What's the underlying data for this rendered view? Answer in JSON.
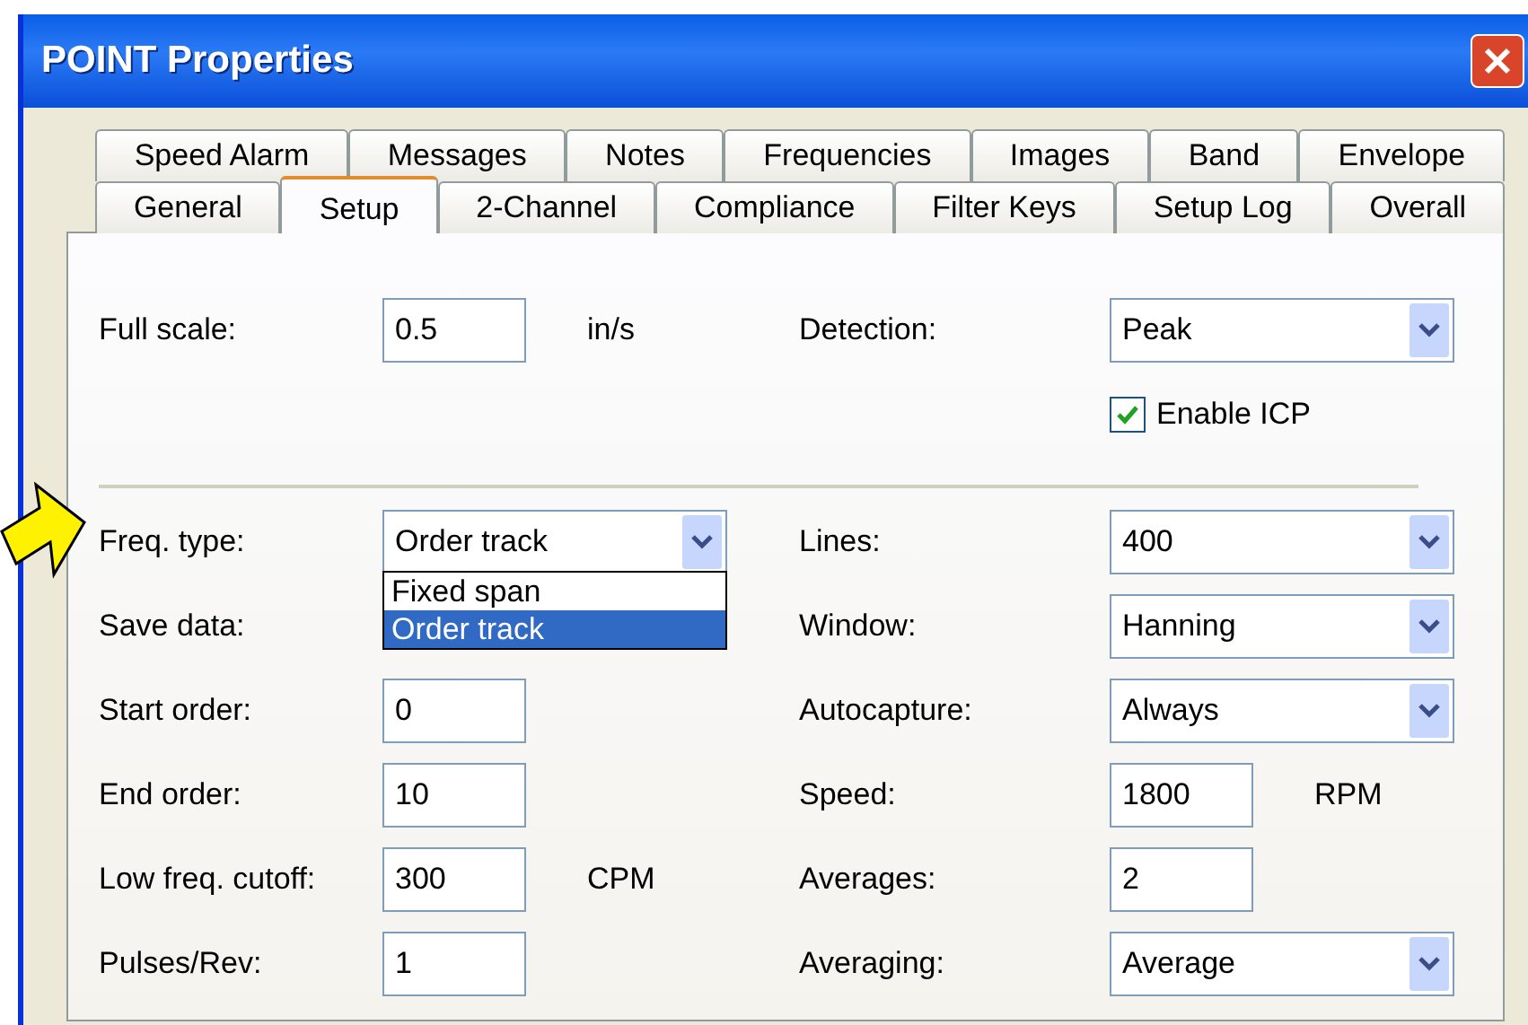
{
  "window": {
    "title": "POINT Properties"
  },
  "tab_rows": [
    {
      "tabs": [
        {
          "label": "Speed Alarm",
          "selected": false
        },
        {
          "label": "Messages",
          "selected": false
        },
        {
          "label": "Notes",
          "selected": false
        },
        {
          "label": "Frequencies",
          "selected": false
        },
        {
          "label": "Images",
          "selected": false
        },
        {
          "label": "Band",
          "selected": false
        },
        {
          "label": "Envelope",
          "selected": false
        }
      ]
    },
    {
      "tabs": [
        {
          "label": "General",
          "selected": false
        },
        {
          "label": "Setup",
          "selected": true
        },
        {
          "label": "2-Channel",
          "selected": false
        },
        {
          "label": "Compliance",
          "selected": false
        },
        {
          "label": "Filter Keys",
          "selected": false
        },
        {
          "label": "Setup Log",
          "selected": false
        },
        {
          "label": "Overall",
          "selected": false
        }
      ]
    }
  ],
  "sections": [
    {
      "rows": [
        {
          "left": {
            "kind": "text",
            "label": "Full scale:",
            "value": "0.5",
            "unit": "in/s"
          },
          "right": {
            "kind": "combo",
            "label": "Detection:",
            "value": "Peak"
          }
        },
        {
          "right": {
            "kind": "check",
            "label": "Enable ICP",
            "checked": true
          }
        }
      ]
    },
    {
      "rows": [
        {
          "left": {
            "kind": "combo",
            "label": "Freq. type:",
            "value": "Order track",
            "options": [
              {
                "label": "Fixed span",
                "selected": false
              },
              {
                "label": "Order track",
                "selected": true
              }
            ]
          },
          "right": {
            "kind": "combo",
            "label": "Lines:",
            "value": "400"
          }
        },
        {
          "left": {
            "kind": "label",
            "label": "Save data:"
          },
          "right": {
            "kind": "combo",
            "label": "Window:",
            "value": "Hanning"
          }
        },
        {
          "left": {
            "kind": "text",
            "label": "Start order:",
            "value": "0"
          },
          "right": {
            "kind": "combo",
            "label": "Autocapture:",
            "value": "Always"
          }
        },
        {
          "left": {
            "kind": "text",
            "label": "End order:",
            "value": "10"
          },
          "right": {
            "kind": "text",
            "label": "Speed:",
            "value": "1800",
            "unit": "RPM"
          }
        },
        {
          "left": {
            "kind": "text",
            "label": "Low freq. cutoff:",
            "value": "300",
            "unit": "CPM"
          },
          "right": {
            "kind": "text",
            "label": "Averages:",
            "value": "2"
          }
        },
        {
          "left": {
            "kind": "text",
            "label": "Pulses/Rev:",
            "value": "1"
          },
          "right": {
            "kind": "combo",
            "label": "Averaging:",
            "value": "Average"
          }
        }
      ]
    }
  ]
}
